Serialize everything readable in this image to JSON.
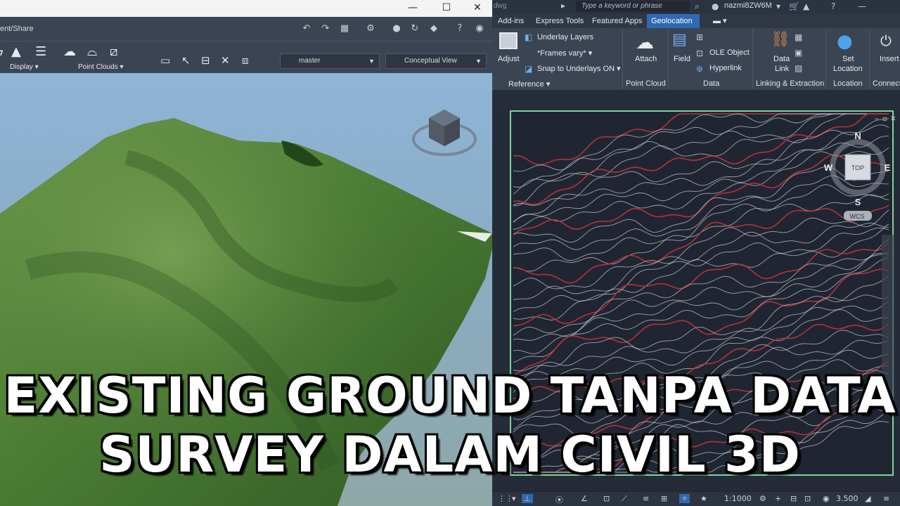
{
  "left_window": {
    "breadcrumb": "ent/Share",
    "ribbon": {
      "display_label": "Display",
      "point_clouds_label": "Point Clouds",
      "master_value": "master",
      "view_value": "Conceptual View"
    }
  },
  "right_window": {
    "file_fragment": "dwg",
    "search_placeholder": "Type a keyword or phrase",
    "username": "nazmi8ZW6M",
    "tabs": [
      {
        "label": "Add-ins"
      },
      {
        "label": "Express Tools"
      },
      {
        "label": "Featured Apps"
      },
      {
        "label": "Geolocation"
      }
    ],
    "ribbon": {
      "adjust": "Adjust",
      "underlay_layers": "Underlay Layers",
      "frames": "*Frames vary*",
      "snap": "Snap to Underlays ON",
      "attach": "Attach",
      "field": "Field",
      "ole_object": "OLE Object",
      "hyperlink": "Hyperlink",
      "data_link_1": "Data",
      "data_link_2": "Link",
      "set_location_1": "Set",
      "set_location_2": "Location",
      "insert": "Insert",
      "groups": {
        "reference": "Reference",
        "point_cloud": "Point Cloud",
        "data": "Data",
        "linking": "Linking & Extraction",
        "location": "Location",
        "connect": "Connect"
      }
    },
    "viewcube": {
      "n": "N",
      "s": "S",
      "e": "E",
      "w": "W",
      "top": "TOP",
      "wcs": "WCS"
    },
    "status": {
      "scale": "1:1000",
      "value": "3.500"
    }
  },
  "overlay": {
    "line1": "EXISTING GROUND TANPA DATA",
    "line2": "SURVEY DALAM CIVIL 3D"
  },
  "colors": {
    "terrain": "#4a7a32",
    "contour_white": "#c9ced6",
    "contour_red": "#c0303a",
    "frame_green": "#7fd39b",
    "tab_active": "#2d6ab3"
  }
}
